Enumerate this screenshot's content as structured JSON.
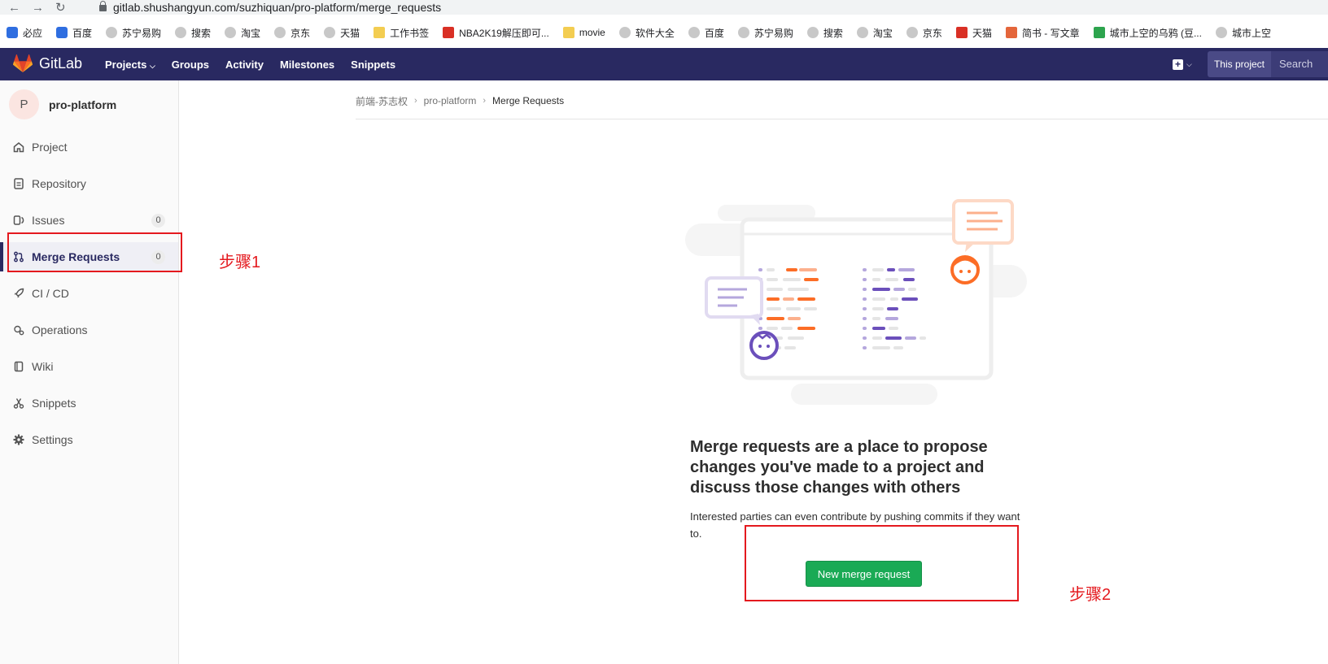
{
  "browser": {
    "url": "gitlab.shushangyun.com/suzhiquan/pro-platform/merge_requests",
    "bookmarks": [
      "必应",
      "百度",
      "苏宁易购",
      "搜索",
      "淘宝",
      "京东",
      "天猫",
      "工作书签",
      "NBA2K19解压即可...",
      "movie",
      "软件大全",
      "百度",
      "苏宁易购",
      "搜索",
      "淘宝",
      "京东",
      "天猫",
      "简书 - 写文章",
      "城市上空的乌鸦 (豆...",
      "城市上空"
    ]
  },
  "header": {
    "brand": "GitLab",
    "nav": [
      "Projects",
      "Groups",
      "Activity",
      "Milestones",
      "Snippets"
    ],
    "this_project": "This project",
    "search_placeholder": "Search"
  },
  "sidebar": {
    "avatar_letter": "P",
    "project_name": "pro-platform",
    "items": [
      {
        "label": "Project",
        "icon": "home-icon"
      },
      {
        "label": "Repository",
        "icon": "doc-icon"
      },
      {
        "label": "Issues",
        "icon": "issues-icon",
        "count": "0"
      },
      {
        "label": "Merge Requests",
        "icon": "merge-request-icon",
        "count": "0"
      },
      {
        "label": "CI / CD",
        "icon": "rocket-icon"
      },
      {
        "label": "Operations",
        "icon": "cloud-gear-icon"
      },
      {
        "label": "Wiki",
        "icon": "book-icon"
      },
      {
        "label": "Snippets",
        "icon": "scissors-icon"
      },
      {
        "label": "Settings",
        "icon": "gear-icon"
      }
    ]
  },
  "breadcrumb": [
    "前端-苏志权",
    "pro-platform",
    "Merge Requests"
  ],
  "empty_state": {
    "title": "Merge requests are a place to propose changes you've made to a project and discuss those changes with others",
    "description": "Interested parties can even contribute by pushing commits if they want to.",
    "button": "New merge request"
  },
  "annotations": {
    "step1": "步骤1",
    "step2": "步骤2",
    "color": "#e4191e"
  },
  "colors": {
    "header_bg": "#292961",
    "primary_green": "#1aaa55"
  }
}
